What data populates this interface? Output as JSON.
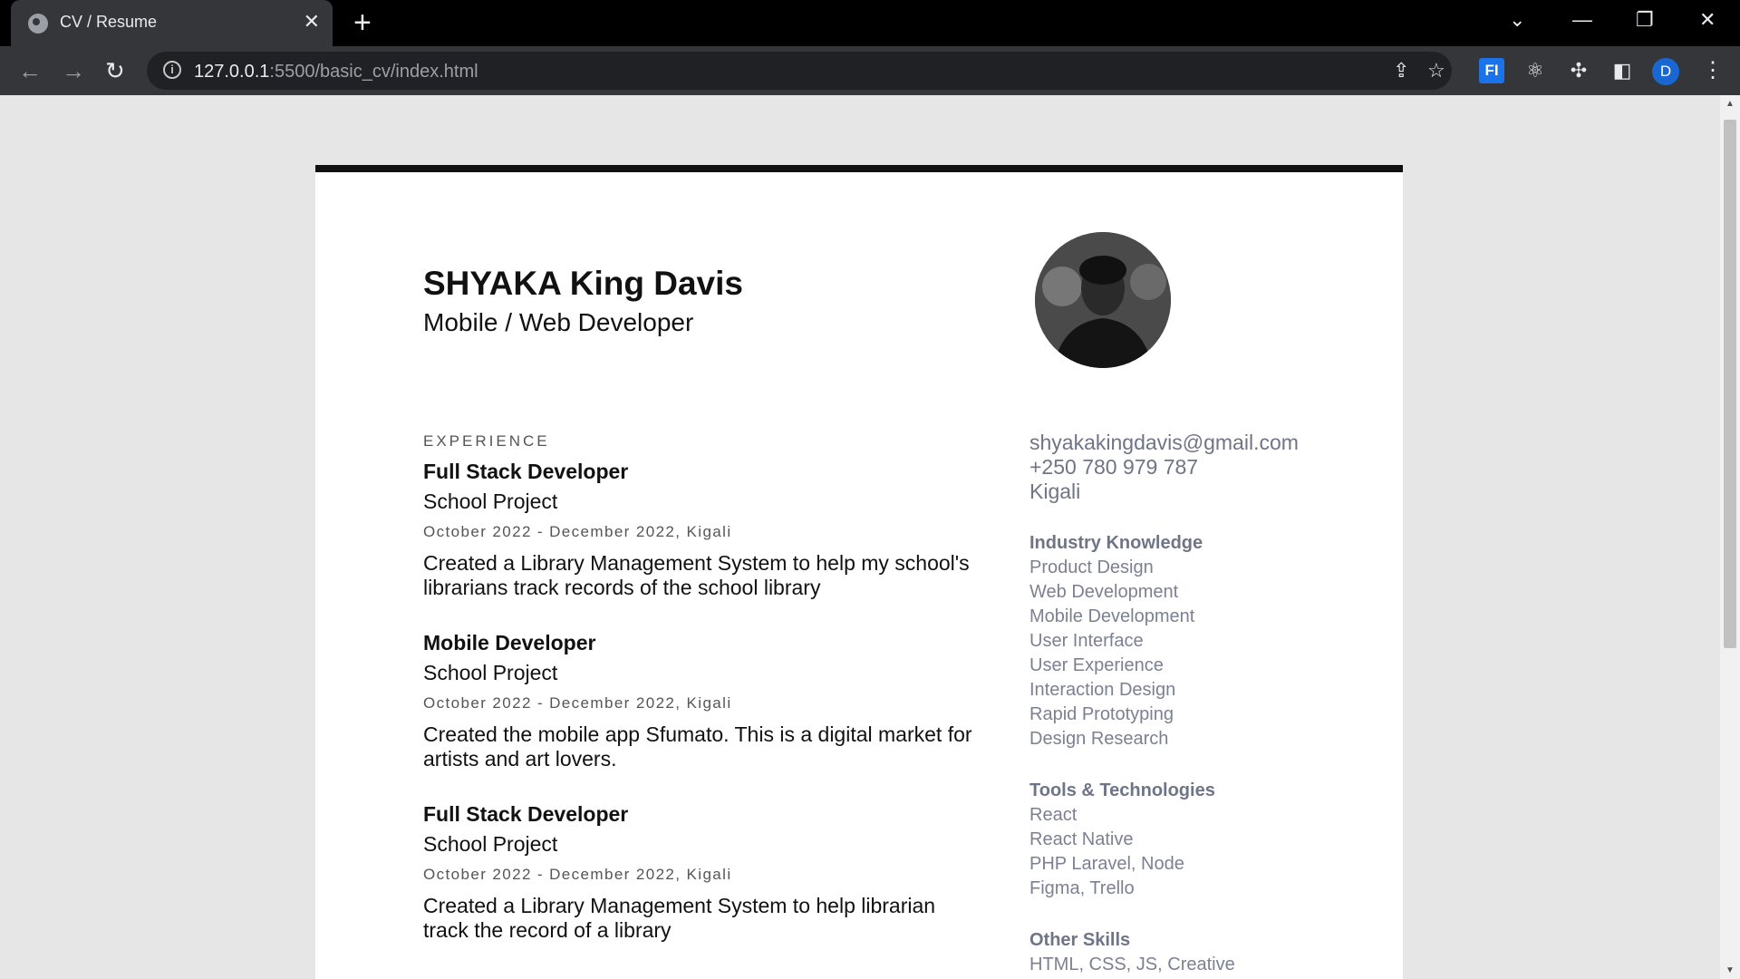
{
  "browser": {
    "tab_title": "CV / Resume",
    "tab_close": "✕",
    "new_tab": "+",
    "url_host": "127.0.0.1",
    "url_rest": ":5500/basic_cv/index.html",
    "profile_initial": "D",
    "extension_fi": "FI"
  },
  "cv": {
    "name": "SHYAKA King Davis",
    "role": "Mobile / Web Developer",
    "experience_label": "EXPERIENCE",
    "jobs": [
      {
        "title": "Full Stack Developer",
        "org": "School Project",
        "meta": "October 2022 - December 2022, Kigali",
        "desc": "Created a Library Management System to help my school's librarians track records of the school library"
      },
      {
        "title": "Mobile Developer",
        "org": "School Project",
        "meta": "October 2022 - December 2022, Kigali",
        "desc": "Created the mobile app Sfumato. This is a digital market for artists and art lovers."
      },
      {
        "title": "Full Stack Developer",
        "org": "School Project",
        "meta": "October 2022 - December 2022, Kigali",
        "desc": "Created a Library Management System to help librarian track the record of a library"
      }
    ],
    "contact": {
      "email": "shyakakingdavis@gmail.com",
      "phone": "+250 780 979 787",
      "city": "Kigali"
    },
    "skills": [
      {
        "title": "Industry Knowledge",
        "items": [
          "Product Design",
          "Web Development",
          "Mobile Development",
          "User Interface",
          "User Experience",
          "Interaction Design",
          "Rapid Prototyping",
          "Design Research"
        ]
      },
      {
        "title": "Tools & Technologies",
        "items": [
          "React",
          "React Native",
          "PHP Laravel, Node",
          "Figma, Trello"
        ]
      },
      {
        "title": "Other Skills",
        "items": [
          "HTML, CSS, JS, Creative"
        ]
      }
    ]
  }
}
